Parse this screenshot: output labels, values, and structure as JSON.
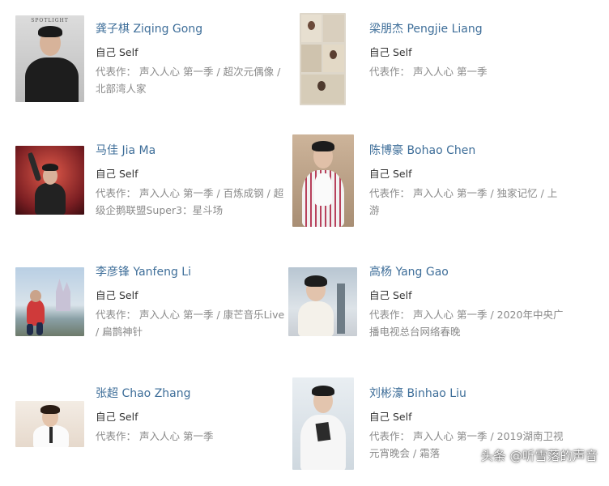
{
  "role_label": "自己 Self",
  "works_prefix": "代表作：",
  "people": [
    {
      "name": "龚子棋 Ziqing Gong",
      "works": "声入人心 第一季 / 超次元偶像 / 北部湾人家",
      "photo_tag": "SPOTLIGHT"
    },
    {
      "name": "梁朋杰 Pengjie Liang",
      "works": "声入人心 第一季"
    },
    {
      "name": "马佳 Jia Ma",
      "works": "声入人心 第一季 / 百炼成钢 / 超级企鹅联盟Super3：星斗场"
    },
    {
      "name": "陈博豪 Bohao Chen",
      "works": "声入人心 第一季 / 独家记忆 / 上游"
    },
    {
      "name": "李彦锋 Yanfeng Li",
      "works": "声入人心 第一季 / 康芒音乐Live / 扁鹊神针"
    },
    {
      "name": "高杨 Yang Gao",
      "works": "声入人心 第一季 / 2020年中央广播电视总台网络春晚"
    },
    {
      "name": "张超 Chao Zhang",
      "works": "声入人心 第一季"
    },
    {
      "name": "刘彬濠 Binhao Liu",
      "works": "声入人心 第一季 / 2019湖南卫视元宵晚会 / 霜落"
    }
  ],
  "watermark": "头条 @听雪落的声音",
  "colors": {
    "name_link": "#3e6e99",
    "role_text": "#333333",
    "works_text": "#8a8a8a"
  }
}
